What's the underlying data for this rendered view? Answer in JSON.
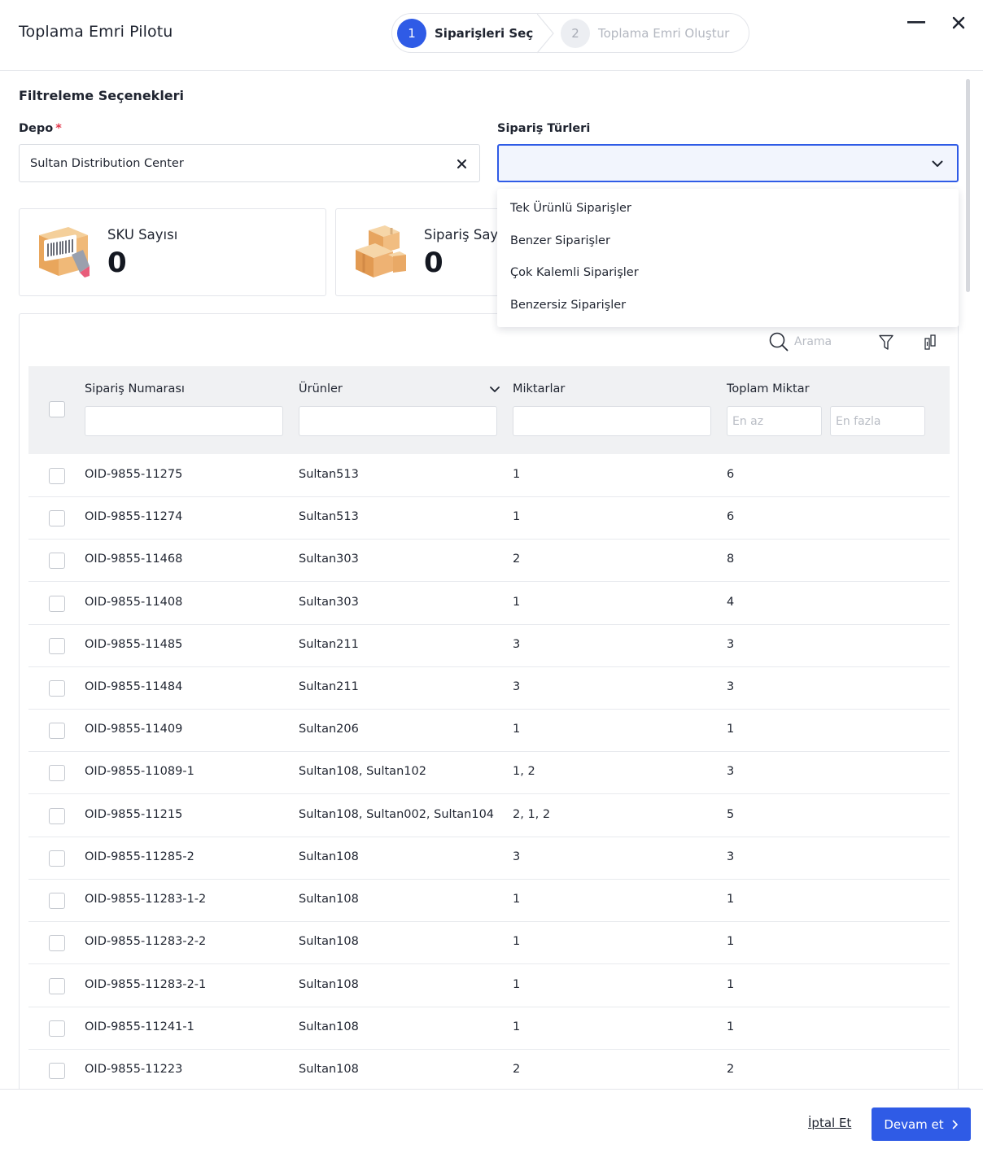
{
  "header": {
    "title": "Toplama Emri Pilotu",
    "steps": [
      {
        "number": "1",
        "label": "Siparişleri Seç"
      },
      {
        "number": "2",
        "label": "Toplama Emri Oluştur"
      }
    ]
  },
  "filters": {
    "section_title": "Filtreleme Seçenekleri",
    "depo_label": "Depo",
    "required_mark": "*",
    "depo_value": "Sultan Distribution Center",
    "types_label": "Sipariş Türleri",
    "types_options": [
      "Tek Ürünlü Siparişler",
      "Benzer Siparişler",
      "Çok Kalemli Siparişler",
      "Benzersiz Siparişler"
    ]
  },
  "stats": {
    "sku_label": "SKU Sayısı",
    "sku_value": "0",
    "order_label": "Sipariş Sayısı",
    "order_value": "0"
  },
  "toolbar": {
    "search_placeholder": "Arama"
  },
  "table": {
    "columns": [
      "Sipariş Numarası",
      "Ürünler",
      "Miktarlar",
      "Toplam Miktar"
    ],
    "min_placeholder": "En az",
    "max_placeholder": "En fazla",
    "rows": [
      {
        "id": "OID-9855-11275",
        "products": "Sultan513",
        "qty": "1",
        "total": "6"
      },
      {
        "id": "OID-9855-11274",
        "products": "Sultan513",
        "qty": "1",
        "total": "6"
      },
      {
        "id": "OID-9855-11468",
        "products": "Sultan303",
        "qty": "2",
        "total": "8"
      },
      {
        "id": "OID-9855-11408",
        "products": "Sultan303",
        "qty": "1",
        "total": "4"
      },
      {
        "id": "OID-9855-11485",
        "products": "Sultan211",
        "qty": "3",
        "total": "3"
      },
      {
        "id": "OID-9855-11484",
        "products": "Sultan211",
        "qty": "3",
        "total": "3"
      },
      {
        "id": "OID-9855-11409",
        "products": "Sultan206",
        "qty": "1",
        "total": "1"
      },
      {
        "id": "OID-9855-11089-1",
        "products": "Sultan108, Sultan102",
        "qty": "1, 2",
        "total": "3"
      },
      {
        "id": "OID-9855-11215",
        "products": "Sultan108, Sultan002, Sultan104",
        "qty": "2, 1, 2",
        "total": "5"
      },
      {
        "id": "OID-9855-11285-2",
        "products": "Sultan108",
        "qty": "3",
        "total": "3"
      },
      {
        "id": "OID-9855-11283-1-2",
        "products": "Sultan108",
        "qty": "1",
        "total": "1"
      },
      {
        "id": "OID-9855-11283-2-2",
        "products": "Sultan108",
        "qty": "1",
        "total": "1"
      },
      {
        "id": "OID-9855-11283-2-1",
        "products": "Sultan108",
        "qty": "1",
        "total": "1"
      },
      {
        "id": "OID-9855-11241-1",
        "products": "Sultan108",
        "qty": "1",
        "total": "1"
      },
      {
        "id": "OID-9855-11223",
        "products": "Sultan108",
        "qty": "2",
        "total": "2"
      }
    ]
  },
  "footer": {
    "cancel_label": "İptal Et",
    "continue_label": "Devam et"
  },
  "colors": {
    "accent": "#2f5be6",
    "required": "#e2364a"
  }
}
